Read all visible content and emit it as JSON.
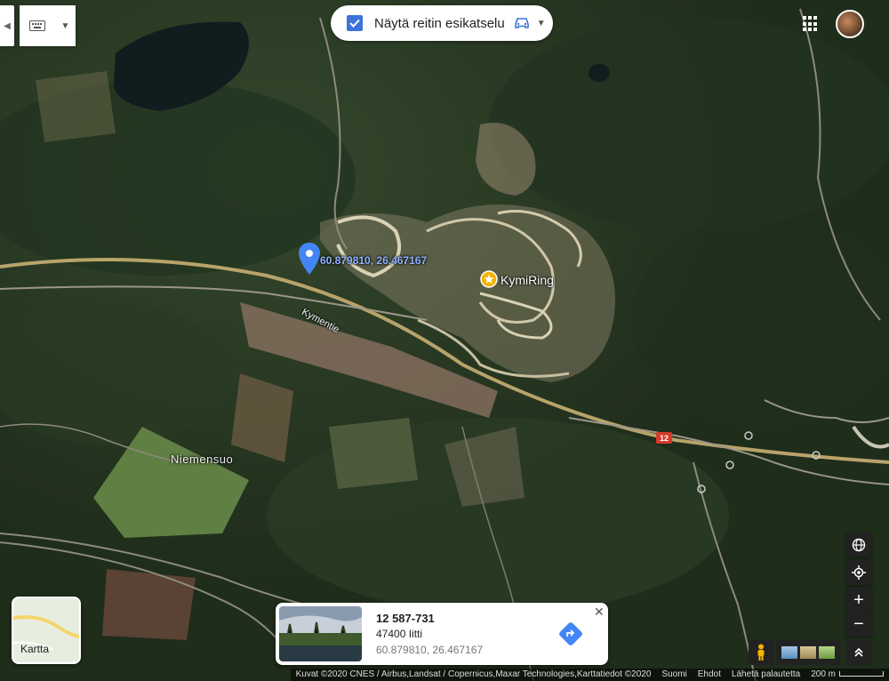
{
  "toolbar": {
    "route_preview_label": "Näytä reitin esikatselu"
  },
  "map": {
    "dropped_pin_coords": "60.879810, 26.467167",
    "poi_label": "KymiRing",
    "road_label": "Kymentie",
    "place_label": "Niemensuo",
    "road_shield": "12"
  },
  "thumbnail": {
    "label": "Kartta"
  },
  "card": {
    "title": "12 587-731",
    "subtitle": "47400 Iitti",
    "coords": "60.879810, 26.467167"
  },
  "controls": {
    "zoom_in": "+",
    "zoom_out": "−"
  },
  "footer": {
    "imagery": "Kuvat ©2020 CNES / Airbus,Landsat / Copernicus,Maxar Technologies,Karttatiedot ©2020",
    "country": "Suomi",
    "terms": "Ehdot",
    "feedback": "Lähetä palautetta",
    "scale": "200 m"
  },
  "colors": {
    "accent": "#3d73d9",
    "pin": "#4285f4",
    "poi": "#f4b400",
    "shield": "#d43b2d"
  }
}
